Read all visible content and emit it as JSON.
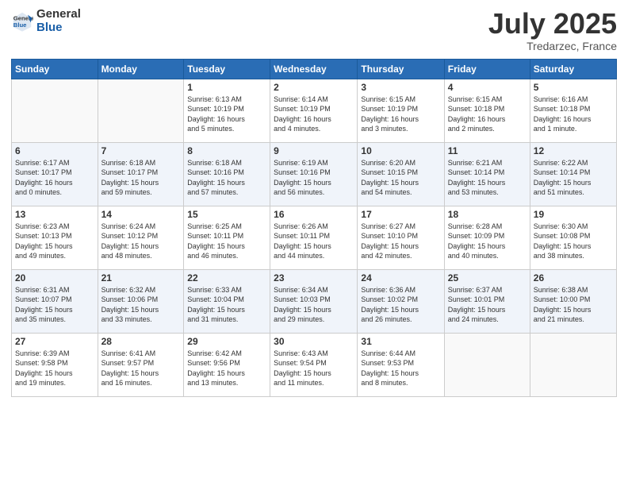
{
  "logo": {
    "line1": "General",
    "line2": "Blue"
  },
  "title": "July 2025",
  "location": "Tredarzec, France",
  "weekdays": [
    "Sunday",
    "Monday",
    "Tuesday",
    "Wednesday",
    "Thursday",
    "Friday",
    "Saturday"
  ],
  "weeks": [
    [
      {
        "day": "",
        "info": ""
      },
      {
        "day": "",
        "info": ""
      },
      {
        "day": "1",
        "info": "Sunrise: 6:13 AM\nSunset: 10:19 PM\nDaylight: 16 hours\nand 5 minutes."
      },
      {
        "day": "2",
        "info": "Sunrise: 6:14 AM\nSunset: 10:19 PM\nDaylight: 16 hours\nand 4 minutes."
      },
      {
        "day": "3",
        "info": "Sunrise: 6:15 AM\nSunset: 10:19 PM\nDaylight: 16 hours\nand 3 minutes."
      },
      {
        "day": "4",
        "info": "Sunrise: 6:15 AM\nSunset: 10:18 PM\nDaylight: 16 hours\nand 2 minutes."
      },
      {
        "day": "5",
        "info": "Sunrise: 6:16 AM\nSunset: 10:18 PM\nDaylight: 16 hours\nand 1 minute."
      }
    ],
    [
      {
        "day": "6",
        "info": "Sunrise: 6:17 AM\nSunset: 10:17 PM\nDaylight: 16 hours\nand 0 minutes."
      },
      {
        "day": "7",
        "info": "Sunrise: 6:18 AM\nSunset: 10:17 PM\nDaylight: 15 hours\nand 59 minutes."
      },
      {
        "day": "8",
        "info": "Sunrise: 6:18 AM\nSunset: 10:16 PM\nDaylight: 15 hours\nand 57 minutes."
      },
      {
        "day": "9",
        "info": "Sunrise: 6:19 AM\nSunset: 10:16 PM\nDaylight: 15 hours\nand 56 minutes."
      },
      {
        "day": "10",
        "info": "Sunrise: 6:20 AM\nSunset: 10:15 PM\nDaylight: 15 hours\nand 54 minutes."
      },
      {
        "day": "11",
        "info": "Sunrise: 6:21 AM\nSunset: 10:14 PM\nDaylight: 15 hours\nand 53 minutes."
      },
      {
        "day": "12",
        "info": "Sunrise: 6:22 AM\nSunset: 10:14 PM\nDaylight: 15 hours\nand 51 minutes."
      }
    ],
    [
      {
        "day": "13",
        "info": "Sunrise: 6:23 AM\nSunset: 10:13 PM\nDaylight: 15 hours\nand 49 minutes."
      },
      {
        "day": "14",
        "info": "Sunrise: 6:24 AM\nSunset: 10:12 PM\nDaylight: 15 hours\nand 48 minutes."
      },
      {
        "day": "15",
        "info": "Sunrise: 6:25 AM\nSunset: 10:11 PM\nDaylight: 15 hours\nand 46 minutes."
      },
      {
        "day": "16",
        "info": "Sunrise: 6:26 AM\nSunset: 10:11 PM\nDaylight: 15 hours\nand 44 minutes."
      },
      {
        "day": "17",
        "info": "Sunrise: 6:27 AM\nSunset: 10:10 PM\nDaylight: 15 hours\nand 42 minutes."
      },
      {
        "day": "18",
        "info": "Sunrise: 6:28 AM\nSunset: 10:09 PM\nDaylight: 15 hours\nand 40 minutes."
      },
      {
        "day": "19",
        "info": "Sunrise: 6:30 AM\nSunset: 10:08 PM\nDaylight: 15 hours\nand 38 minutes."
      }
    ],
    [
      {
        "day": "20",
        "info": "Sunrise: 6:31 AM\nSunset: 10:07 PM\nDaylight: 15 hours\nand 35 minutes."
      },
      {
        "day": "21",
        "info": "Sunrise: 6:32 AM\nSunset: 10:06 PM\nDaylight: 15 hours\nand 33 minutes."
      },
      {
        "day": "22",
        "info": "Sunrise: 6:33 AM\nSunset: 10:04 PM\nDaylight: 15 hours\nand 31 minutes."
      },
      {
        "day": "23",
        "info": "Sunrise: 6:34 AM\nSunset: 10:03 PM\nDaylight: 15 hours\nand 29 minutes."
      },
      {
        "day": "24",
        "info": "Sunrise: 6:36 AM\nSunset: 10:02 PM\nDaylight: 15 hours\nand 26 minutes."
      },
      {
        "day": "25",
        "info": "Sunrise: 6:37 AM\nSunset: 10:01 PM\nDaylight: 15 hours\nand 24 minutes."
      },
      {
        "day": "26",
        "info": "Sunrise: 6:38 AM\nSunset: 10:00 PM\nDaylight: 15 hours\nand 21 minutes."
      }
    ],
    [
      {
        "day": "27",
        "info": "Sunrise: 6:39 AM\nSunset: 9:58 PM\nDaylight: 15 hours\nand 19 minutes."
      },
      {
        "day": "28",
        "info": "Sunrise: 6:41 AM\nSunset: 9:57 PM\nDaylight: 15 hours\nand 16 minutes."
      },
      {
        "day": "29",
        "info": "Sunrise: 6:42 AM\nSunset: 9:56 PM\nDaylight: 15 hours\nand 13 minutes."
      },
      {
        "day": "30",
        "info": "Sunrise: 6:43 AM\nSunset: 9:54 PM\nDaylight: 15 hours\nand 11 minutes."
      },
      {
        "day": "31",
        "info": "Sunrise: 6:44 AM\nSunset: 9:53 PM\nDaylight: 15 hours\nand 8 minutes."
      },
      {
        "day": "",
        "info": ""
      },
      {
        "day": "",
        "info": ""
      }
    ]
  ]
}
